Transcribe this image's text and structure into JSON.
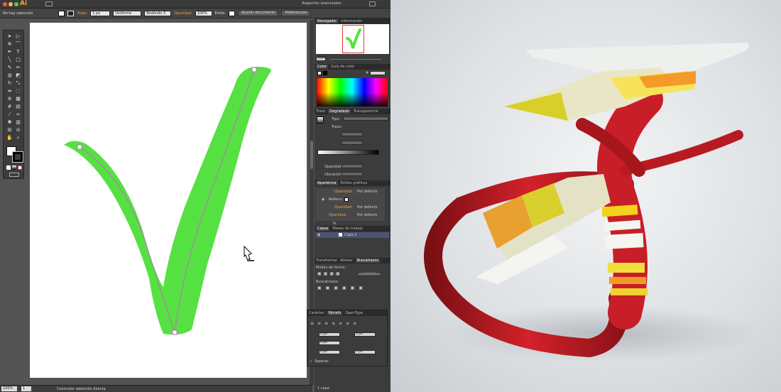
{
  "app": {
    "workspace": "Aspectos esenciales",
    "logo_text": "Ai"
  },
  "control_bar": {
    "selection": "No hay selección",
    "stroke_label": "Trazo:",
    "stroke_value": "1 px",
    "profile": "Uniforme",
    "brush": "Redondo 3",
    "opacity_label": "Opacidad:",
    "opacity_value": "100%",
    "style_label": "Estilo:",
    "doc_setup_button": "Ajustar documento",
    "prefs_button": "Preferencias"
  },
  "navigator": {
    "tab_active": "Navegador",
    "tab_other": "Información",
    "zoom": "100%"
  },
  "color_panel": {
    "tab_active": "Color",
    "tab_other": "Guía de color",
    "hex": "#"
  },
  "gradient_panel": {
    "tabs": [
      "Trazo",
      "Degradado",
      "Transparencia"
    ],
    "type_label": "Tipo:",
    "stroke_label": "Trazo:",
    "opacity_label": "Opacidad:",
    "location_label": "Ubicación:"
  },
  "appearance_panel": {
    "tabs": [
      "Apariencia",
      "Estilos gráficos"
    ],
    "rows": [
      {
        "label": "Opacidad:",
        "value": "Por defecto"
      },
      {
        "label": "Relleno:",
        "value": ""
      },
      {
        "label": "Opacidad:",
        "value": "Por defecto"
      },
      {
        "label": "Opacidad:",
        "value": "Por defecto"
      }
    ],
    "fx": "fx."
  },
  "layers_panel": {
    "tabs": [
      "Capas",
      "Mesas de trabajo"
    ],
    "layer_name": "Capa 1",
    "footer": "1 capa"
  },
  "pathfinder_panel": {
    "tabs": [
      "Transformar",
      "Alinear",
      "Buscatrazos"
    ],
    "shape_modes": "Modos de forma:",
    "expand_button": "Expandir",
    "pathfinders": "Buscatrazos:"
  },
  "paragraph_panel": {
    "tabs": [
      "Carácter",
      "Párrafo",
      "OpenType"
    ],
    "fields": [
      "0 px",
      "0 px",
      "0 px",
      "0 px",
      "0 px"
    ],
    "hyphenate": "Separar"
  },
  "status_bar": {
    "zoom": "100%",
    "page": "1",
    "tool": "Conmutar selección directa"
  },
  "colors": {
    "checkmark_green": "#55e141",
    "path_magenta": "#c06ac8",
    "ai_orange": "#f7a823"
  }
}
